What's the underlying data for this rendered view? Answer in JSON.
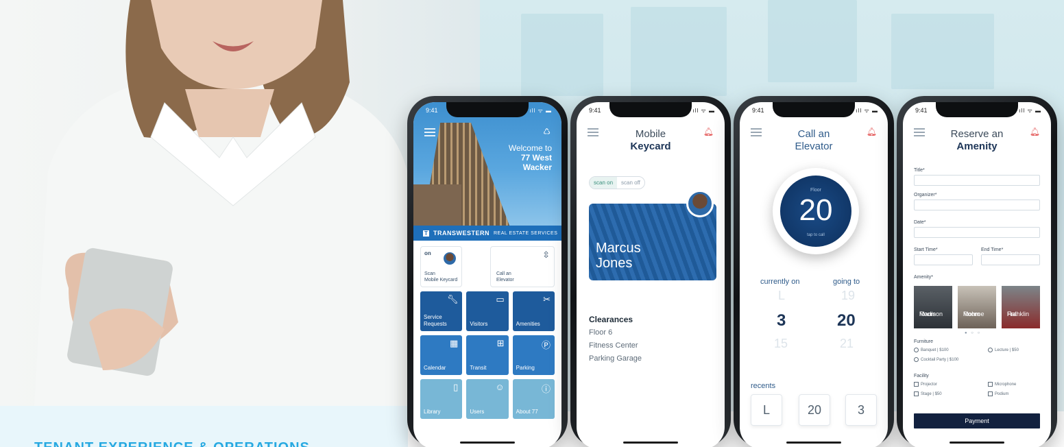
{
  "tagline": "TENANT EXPERIENCE & OPERATIONS",
  "status_time": "9:41",
  "status_icons": "ıll ᯤ ▬",
  "phone1": {
    "welcome_line1": "Welcome to",
    "welcome_line2": "77 West",
    "welcome_line3": "Wacker",
    "brand_name": "TRANSWESTERN",
    "brand_sub": "REAL ESTATE SERVICES",
    "tile_scan_state": "on",
    "tile_scan_l1": "Scan",
    "tile_scan_l2": "Mobile Keycard",
    "tile_call_l1": "Call an",
    "tile_call_l2": "Elevator",
    "tiles": [
      {
        "l1": "Service",
        "l2": "Requests",
        "icon": "wrench-icon"
      },
      {
        "l1": "Visitors",
        "l2": "",
        "icon": "id-card-icon"
      },
      {
        "l1": "Amenities",
        "l2": "",
        "icon": "tools-icon"
      },
      {
        "l1": "Calendar",
        "l2": "",
        "icon": "calendar-icon"
      },
      {
        "l1": "Transit",
        "l2": "",
        "icon": "bus-icon"
      },
      {
        "l1": "Parking",
        "l2": "",
        "icon": "parking-icon"
      },
      {
        "l1": "Library",
        "l2": "",
        "icon": "book-icon"
      },
      {
        "l1": "Users",
        "l2": "",
        "icon": "users-icon"
      },
      {
        "l1": "About 77",
        "l2": "",
        "icon": "info-icon"
      }
    ]
  },
  "phone2": {
    "title_l1": "Mobile",
    "title_l2": "Keycard",
    "scan_on": "scan on",
    "scan_off": "scan off",
    "card_first": "Marcus",
    "card_last": "Jones",
    "clearances_title": "Clearances",
    "clearances": [
      "Floor 6",
      "Fitness Center",
      "Parking Garage"
    ]
  },
  "phone3": {
    "title_l1": "Call an",
    "title_l2": "Elevator",
    "floor_label": "Floor",
    "floor_num": "20",
    "tap_label": "tap to call",
    "current_head": "currently on",
    "going_head": "going to",
    "current_prev": "L",
    "current_val": "3",
    "current_next": "15",
    "going_prev": "19",
    "going_val": "20",
    "going_next": "21",
    "recents_label": "recents",
    "recents": [
      "L",
      "20",
      "3"
    ]
  },
  "phone4": {
    "title_l1": "Reserve an",
    "title_l2": "Amenity",
    "title_field": "Title*",
    "organizer_field": "Organizer*",
    "date_field": "Date*",
    "start_field": "Start Time*",
    "end_field": "End Time*",
    "amenity_label": "Amenity*",
    "amenities": [
      {
        "l1": "Madison",
        "l2": "Room"
      },
      {
        "l1": "Mohroe",
        "l2": "Room"
      },
      {
        "l1": "Franklin",
        "l2": "Hall"
      }
    ],
    "dots": "● ○ ○",
    "furniture_label": "Furniture",
    "furniture": [
      "Banquet | $100",
      "Lecture | $50",
      "Cocktail Party | $100"
    ],
    "facility_label": "Facility",
    "facility": [
      "Projector",
      "Microphone",
      "Stage | $50",
      "Podium"
    ],
    "payment": "Payment"
  }
}
